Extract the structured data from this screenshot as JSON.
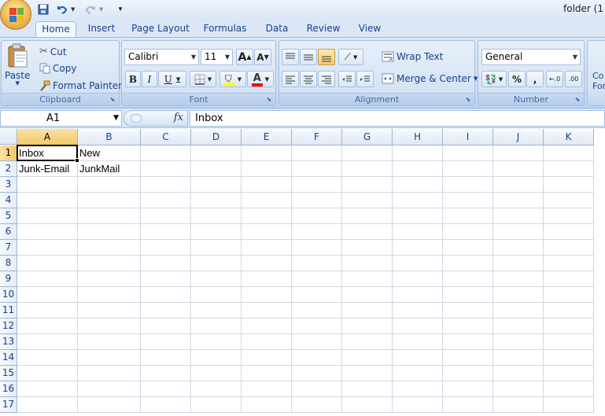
{
  "window": {
    "title": "folder (1"
  },
  "icons": {
    "save": "save-icon",
    "undo": "undo-icon",
    "redo": "redo-icon",
    "customize": "customize-qat-icon",
    "cut": "scissors-icon",
    "copy": "copy-icon",
    "format_painter": "brush-icon"
  },
  "tabs": [
    {
      "label": "Home",
      "active": true
    },
    {
      "label": "Insert"
    },
    {
      "label": "Page Layout"
    },
    {
      "label": "Formulas"
    },
    {
      "label": "Data"
    },
    {
      "label": "Review"
    },
    {
      "label": "View"
    }
  ],
  "ribbon": {
    "clipboard": {
      "label": "Clipboard",
      "paste": "Paste",
      "cut": "Cut",
      "copy": "Copy",
      "format_painter": "Format Painter"
    },
    "font": {
      "label": "Font",
      "font_name": "Calibri",
      "font_size": "11",
      "bold": "B",
      "italic": "I",
      "underline": "U",
      "grow": "A",
      "shrink": "A",
      "font_color_letter": "A",
      "font_color": "#ff0000",
      "fill_color": "#ffff00"
    },
    "alignment": {
      "label": "Alignment",
      "wrap_text": "Wrap Text",
      "merge_center": "Merge & Center"
    },
    "number": {
      "label": "Number",
      "format": "General",
      "percent": "%",
      "comma": ",",
      "inc_decimal": "←.0",
      "dec_decimal": ".00"
    },
    "styles": {
      "cond_format_line1": "Co",
      "cond_format_line2": "For"
    }
  },
  "formula_bar": {
    "name_box": "A1",
    "fx": "fx",
    "value": "Inbox"
  },
  "sheet": {
    "columns": [
      "A",
      "B",
      "C",
      "D",
      "E",
      "F",
      "G",
      "H",
      "I",
      "J",
      "K"
    ],
    "rows": [
      "1",
      "2",
      "3",
      "4",
      "5",
      "6",
      "7",
      "8",
      "9",
      "10",
      "11",
      "12",
      "13",
      "14",
      "15",
      "16",
      "17"
    ],
    "cells": {
      "A1": "Inbox",
      "B1": "New",
      "A2": "Junk-Email",
      "B2": "JunkMail"
    },
    "active_cell": "A1"
  }
}
